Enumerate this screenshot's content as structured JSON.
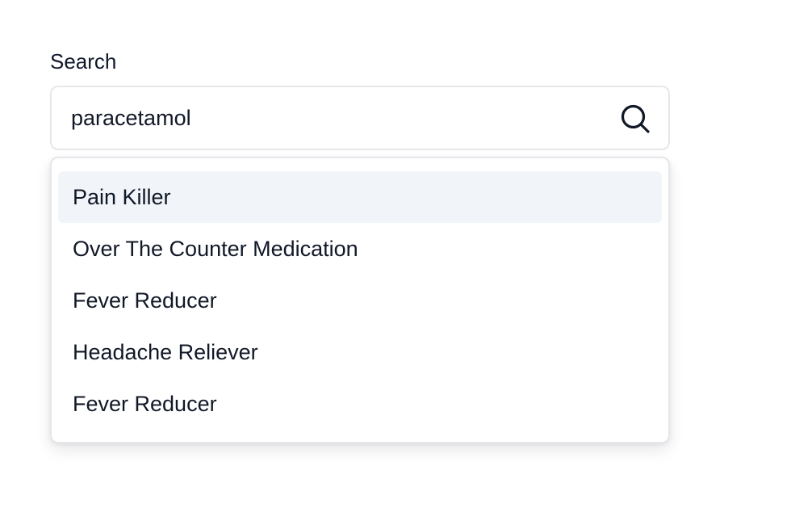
{
  "search": {
    "label": "Search",
    "value": "paracetamol",
    "icon": "search-icon"
  },
  "dropdown": {
    "highlight_color": "#f1f5f9",
    "options": [
      {
        "label": "Pain Killer",
        "highlighted": true
      },
      {
        "label": "Over The Counter Medication",
        "highlighted": false
      },
      {
        "label": "Fever Reducer",
        "highlighted": false
      },
      {
        "label": "Headache Reliever",
        "highlighted": false
      },
      {
        "label": "Fever Reducer",
        "highlighted": false
      }
    ]
  }
}
